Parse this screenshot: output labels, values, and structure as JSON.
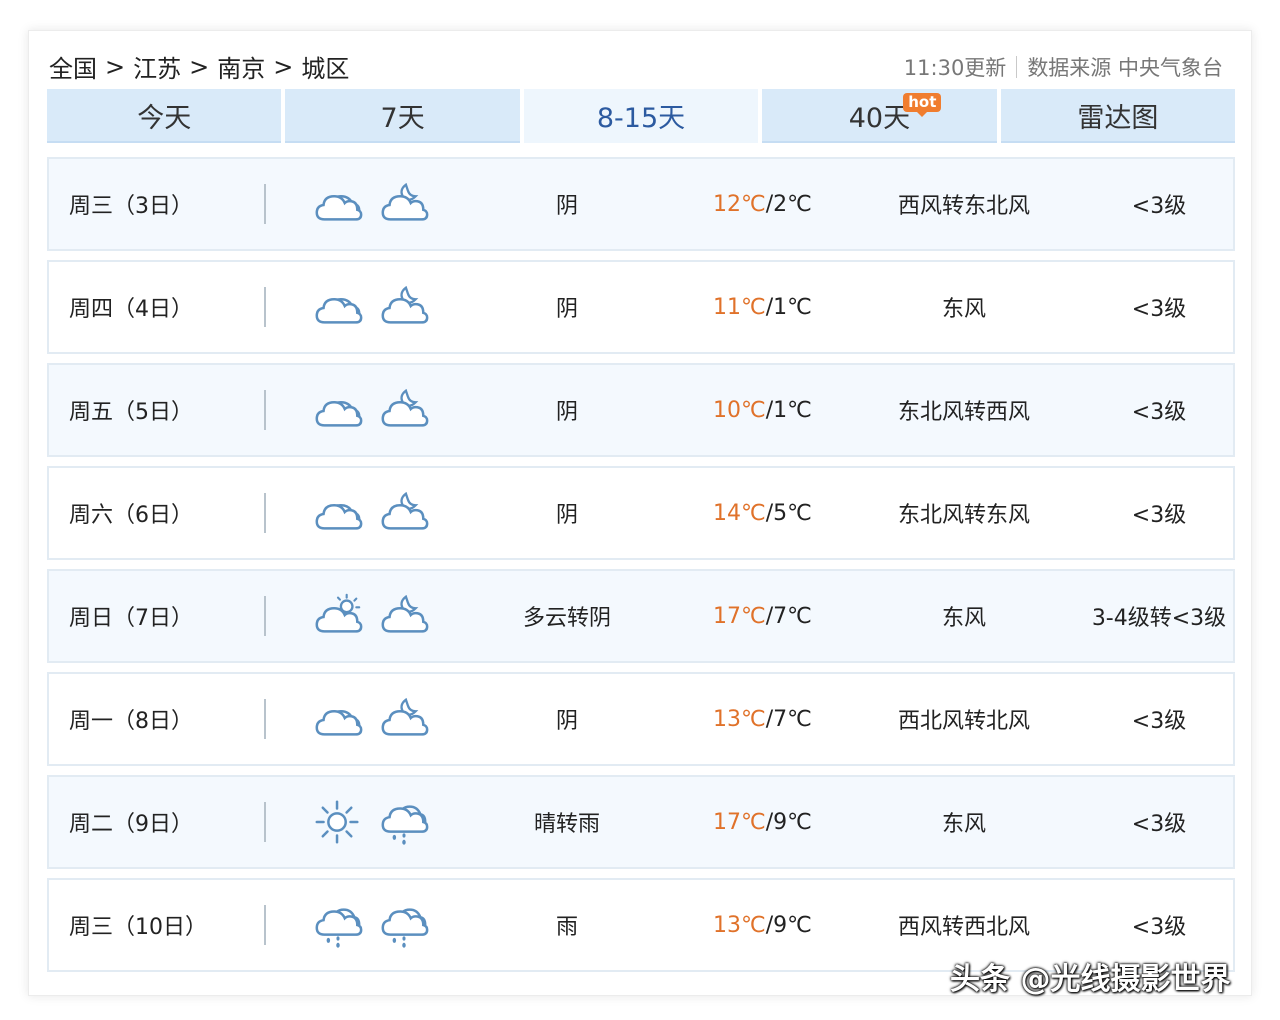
{
  "breadcrumb": [
    "全国",
    "江苏",
    "南京",
    "城区"
  ],
  "breadcrumb_sep": ">",
  "update_time": "11:30更新",
  "source": "数据来源 中央气象台",
  "tabs": [
    {
      "label": "今天",
      "active": false
    },
    {
      "label": "7天",
      "active": false
    },
    {
      "label": "8-15天",
      "active": true
    },
    {
      "label": "40天",
      "active": false,
      "badge": "hot"
    },
    {
      "label": "雷达图",
      "active": false
    }
  ],
  "colors": {
    "accent": "#2c5aa0",
    "temp_high": "#e0722a",
    "tab_bg": "#d9eaf9",
    "icon": "#5b8fbf"
  },
  "days": [
    {
      "day": "周三（3日）",
      "icon_day": "cloud-icon",
      "icon_night": "cloud-moon-icon",
      "condition": "阴",
      "high": "12℃",
      "low": "2℃",
      "wind": "西风转东北风",
      "level": "<3级"
    },
    {
      "day": "周四（4日）",
      "icon_day": "cloud-icon",
      "icon_night": "cloud-moon-icon",
      "condition": "阴",
      "high": "11℃",
      "low": "1℃",
      "wind": "东风",
      "level": "<3级"
    },
    {
      "day": "周五（5日）",
      "icon_day": "cloud-icon",
      "icon_night": "cloud-moon-icon",
      "condition": "阴",
      "high": "10℃",
      "low": "1℃",
      "wind": "东北风转西风",
      "level": "<3级"
    },
    {
      "day": "周六（6日）",
      "icon_day": "cloud-icon",
      "icon_night": "cloud-moon-icon",
      "condition": "阴",
      "high": "14℃",
      "low": "5℃",
      "wind": "东北风转东风",
      "level": "<3级"
    },
    {
      "day": "周日（7日）",
      "icon_day": "cloud-sun-icon",
      "icon_night": "cloud-moon-icon",
      "condition": "多云转阴",
      "high": "17℃",
      "low": "7℃",
      "wind": "东风",
      "level": "3-4级转<3级"
    },
    {
      "day": "周一（8日）",
      "icon_day": "cloud-icon",
      "icon_night": "cloud-moon-icon",
      "condition": "阴",
      "high": "13℃",
      "low": "7℃",
      "wind": "西北风转北风",
      "level": "<3级"
    },
    {
      "day": "周二（9日）",
      "icon_day": "sun-icon",
      "icon_night": "rain-cloud-icon",
      "condition": "晴转雨",
      "high": "17℃",
      "low": "9℃",
      "wind": "东风",
      "level": "<3级"
    },
    {
      "day": "周三（10日）",
      "icon_day": "rain-cloud-icon",
      "icon_night": "rain-cloud-icon",
      "condition": "雨",
      "high": "13℃",
      "low": "9℃",
      "wind": "西风转西北风",
      "level": "<3级"
    }
  ],
  "watermark": "头条 @光线摄影世界"
}
